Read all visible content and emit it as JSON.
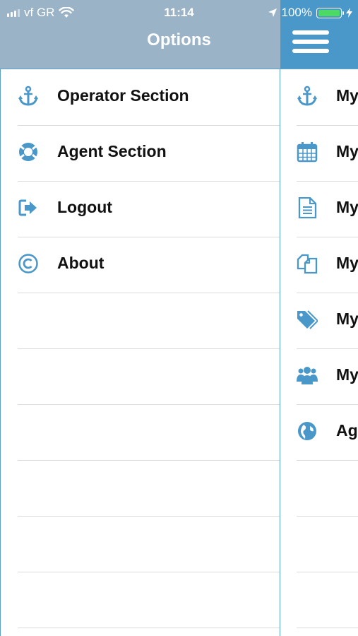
{
  "status_bar": {
    "carrier": "vf GR",
    "time": "11:14",
    "battery": "100%",
    "icons": [
      "signal-icon",
      "wifi-icon",
      "location-arrow-icon",
      "battery-icon",
      "charging-bolt-icon"
    ]
  },
  "drawer": {
    "title": "Options",
    "items": [
      {
        "label": "Operator Section",
        "icon": "anchor-icon"
      },
      {
        "label": "Agent Section",
        "icon": "life-ring-icon"
      },
      {
        "label": "Logout",
        "icon": "sign-out-icon"
      },
      {
        "label": "About",
        "icon": "copyright-icon"
      }
    ]
  },
  "main": {
    "menu_icon": "hamburger-menu-icon",
    "items": [
      {
        "label": "My",
        "icon": "anchor-icon"
      },
      {
        "label": "My",
        "icon": "calendar-icon"
      },
      {
        "label": "My",
        "icon": "document-icon"
      },
      {
        "label": "My",
        "icon": "copy-files-icon"
      },
      {
        "label": "My",
        "icon": "tags-icon"
      },
      {
        "label": "My",
        "icon": "users-icon"
      },
      {
        "label": "Ag",
        "icon": "globe-icon"
      }
    ]
  },
  "colors": {
    "drawer_header": "#9bb3c7",
    "main_header": "#4a97c9",
    "icon_blue": "#4a97c9",
    "border_blue": "#5aa0c8",
    "divider": "#dcdcdc"
  }
}
